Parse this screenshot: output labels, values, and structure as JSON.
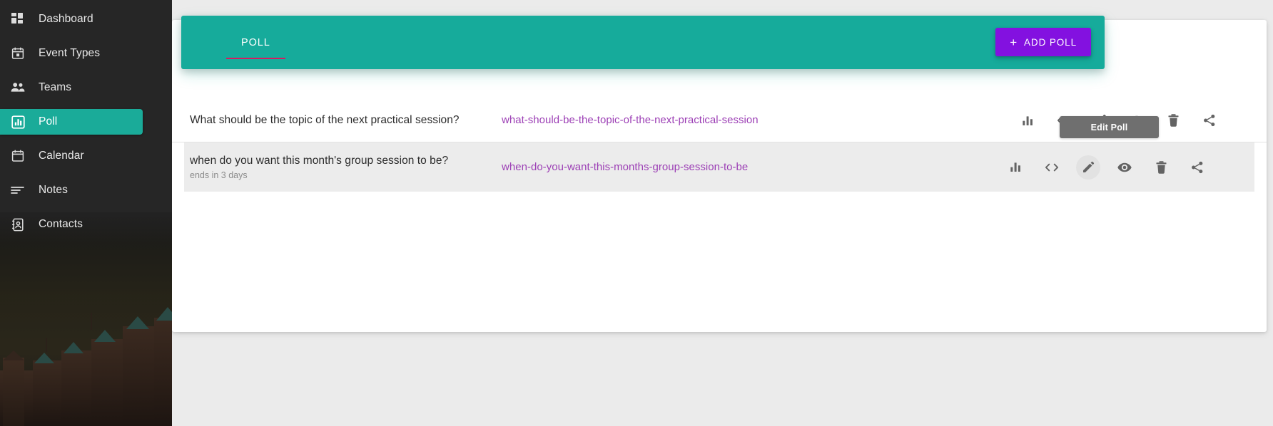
{
  "sidebar": {
    "items": [
      {
        "label": "Dashboard",
        "icon": "dashboard-grid-icon",
        "active": false
      },
      {
        "label": "Event Types",
        "icon": "calendar-event-icon",
        "active": false
      },
      {
        "label": "Teams",
        "icon": "people-group-icon",
        "active": false
      },
      {
        "label": "Poll",
        "icon": "bar-chart-icon",
        "active": true
      },
      {
        "label": "Calendar",
        "icon": "calendar-icon",
        "active": false
      },
      {
        "label": "Notes",
        "icon": "notes-lines-icon",
        "active": false
      },
      {
        "label": "Contacts",
        "icon": "contact-card-icon",
        "active": false
      }
    ]
  },
  "header": {
    "tabs": [
      {
        "label": "POLL",
        "active": true
      }
    ],
    "add_button": {
      "label": "ADD POLL",
      "plus": "+"
    },
    "accent_color": "#16ab9b",
    "tab_underline_color": "#d81b60",
    "add_button_color": "#8311e0"
  },
  "polls": [
    {
      "title": "What should be the topic of the next practical session?",
      "subtitle": "",
      "slug": "what-should-be-the-topic-of-the-next-practical-session",
      "highlighted": false,
      "hovered_action": ""
    },
    {
      "title": "when do you want this month's group session to be?",
      "subtitle": "ends in 3 days",
      "slug": "when-do-you-want-this-months-group-session-to-be",
      "highlighted": true,
      "hovered_action": "edit"
    }
  ],
  "actions": [
    {
      "key": "results",
      "icon": "bar-chart-icon"
    },
    {
      "key": "embed",
      "icon": "code-brackets-icon"
    },
    {
      "key": "edit",
      "icon": "pencil-edit-icon"
    },
    {
      "key": "preview",
      "icon": "eye-icon"
    },
    {
      "key": "delete",
      "icon": "trash-icon"
    },
    {
      "key": "share",
      "icon": "share-icon"
    }
  ],
  "tooltip": {
    "text": "Edit Poll"
  },
  "link_color": "#9c3fb5"
}
